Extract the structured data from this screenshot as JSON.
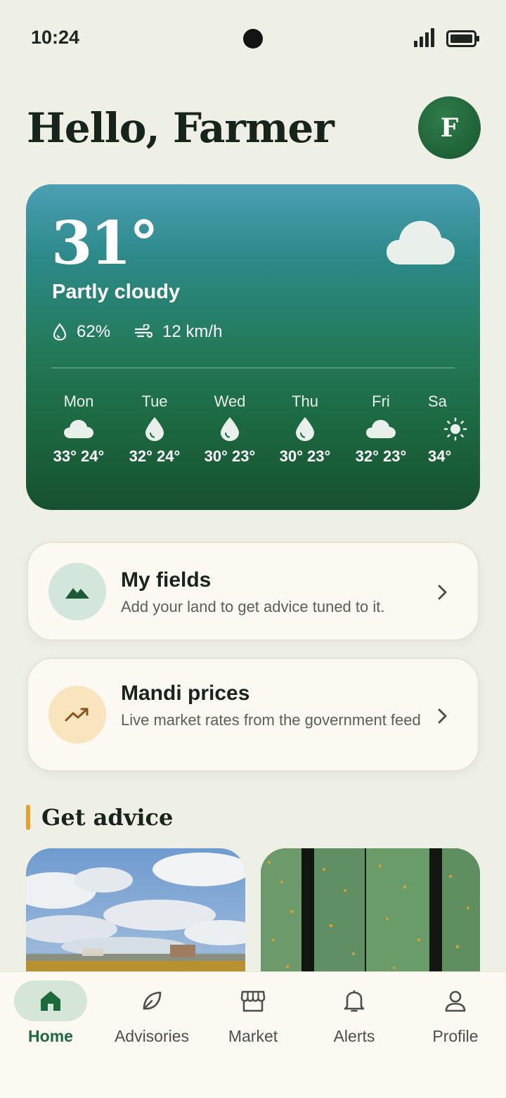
{
  "status_bar": {
    "time": "10:24"
  },
  "header": {
    "greeting": "Hello, Farmer",
    "avatar_initial": "F"
  },
  "weather": {
    "temperature": "31°",
    "condition": "Partly cloudy",
    "humidity": "62%",
    "wind": "12 km/h",
    "forecast": [
      {
        "day": "Mon",
        "icon": "cloud-icon",
        "temps": "33° 24°"
      },
      {
        "day": "Tue",
        "icon": "raindrop-icon",
        "temps": "32° 24°"
      },
      {
        "day": "Wed",
        "icon": "raindrop-icon",
        "temps": "30° 23°"
      },
      {
        "day": "Thu",
        "icon": "raindrop-icon",
        "temps": "30° 23°"
      },
      {
        "day": "Fri",
        "icon": "cloud-icon",
        "temps": "32° 23°"
      },
      {
        "day": "Sa",
        "icon": "sun-icon",
        "temps": "34°"
      }
    ]
  },
  "cards": {
    "fields": {
      "title": "My fields",
      "subtitle": "Add your land to get advice tuned to it.",
      "icon": "mountain-icon"
    },
    "mandi": {
      "title": "Mandi prices",
      "subtitle": "Live market rates from the government feed",
      "icon": "trending-up-icon"
    }
  },
  "advice": {
    "section_title": "Get advice"
  },
  "nav": {
    "items": [
      {
        "label": "Home",
        "icon": "home-icon",
        "active": true
      },
      {
        "label": "Advisories",
        "icon": "leaf-icon",
        "active": false
      },
      {
        "label": "Market",
        "icon": "store-icon",
        "active": false
      },
      {
        "label": "Alerts",
        "icon": "bell-icon",
        "active": false
      },
      {
        "label": "Profile",
        "icon": "person-icon",
        "active": false
      }
    ]
  },
  "colors": {
    "background": "#eeefe5",
    "primary": "#1c6a3c",
    "accent": "#e3a32b",
    "card": "#fbf9f1"
  }
}
